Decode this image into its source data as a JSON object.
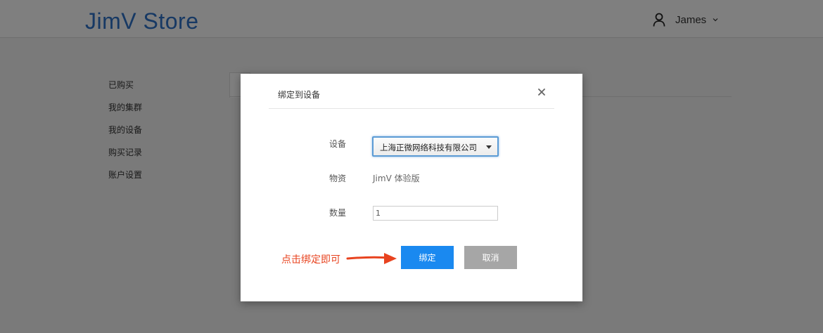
{
  "header": {
    "brand": "JimV Store",
    "user_name": "James",
    "user_icon": "user-icon",
    "dropdown_icon": "chevron-down-icon"
  },
  "sidebar": {
    "items": [
      {
        "label": "已购买"
      },
      {
        "label": "我的集群"
      },
      {
        "label": "我的设备"
      },
      {
        "label": "购买记录"
      },
      {
        "label": "账户设置"
      }
    ]
  },
  "modal": {
    "title": "绑定到设备",
    "close_icon": "close-icon",
    "device_label": "设备",
    "device_selected": "上海正微网络科技有限公司",
    "material_label": "物资",
    "material_value": "JimV 体验版",
    "quantity_label": "数量",
    "quantity_value": "1",
    "bind_label": "绑定",
    "cancel_label": "取消"
  },
  "annotation": {
    "text": "点击绑定即可",
    "color": "#e8431f"
  },
  "colors": {
    "brand": "#2e72c8",
    "primary": "#1a89f0",
    "cancel": "#a6a6a6"
  }
}
